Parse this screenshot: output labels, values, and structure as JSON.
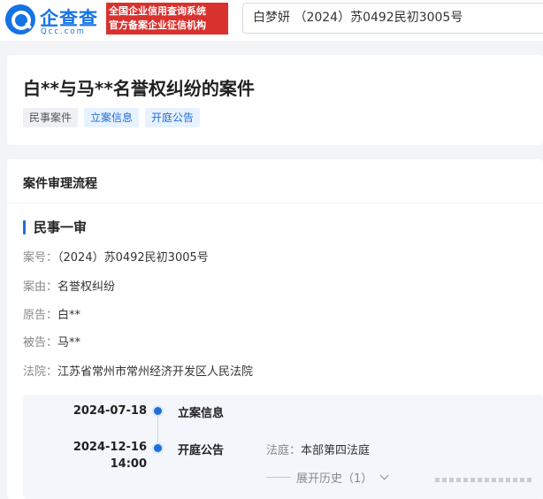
{
  "header": {
    "logo_name": "企查查",
    "logo_domain": "Qcc.com",
    "badge_line1": "全国企业信用查询系统",
    "badge_line2": "官方备案企业征信机构",
    "search_query": "白梦妍 （2024）苏0492民初3005号"
  },
  "case": {
    "title": "白**与马**名誉权纠纷的案件",
    "tags": [
      "民事案件",
      "立案信息",
      "开庭公告"
    ]
  },
  "process": {
    "section_title": "案件审理流程",
    "stage_title": "民事一审",
    "fields": [
      {
        "key": "案号：",
        "value": "（2024）苏0492民初3005号"
      },
      {
        "key": "案由：",
        "value": "名誉权纠纷"
      },
      {
        "key": "原告：",
        "value": "白**"
      },
      {
        "key": "被告：",
        "value": "马**"
      },
      {
        "key": "法院：",
        "value": "江苏省常州市常州经济开发区人民法院"
      }
    ],
    "timeline": [
      {
        "date": "2024-07-18",
        "time": "",
        "label": "立案信息",
        "court_key": "",
        "court_value": ""
      },
      {
        "date": "2024-12-16",
        "time": "14:00",
        "label": "开庭公告",
        "court_key": "法庭：",
        "court_value": "本部第四法庭"
      }
    ],
    "history_label": "展开历史（1）"
  },
  "colors": {
    "brand_blue": "#1473e6",
    "badge_red": "#d9322e",
    "accent_blue": "#1f6fd8"
  }
}
